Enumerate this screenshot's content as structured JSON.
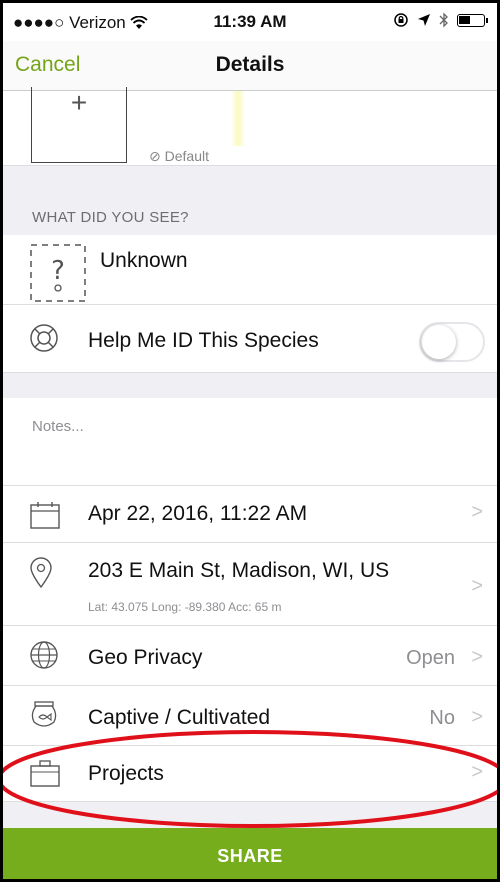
{
  "status_bar": {
    "carrier": "●●●●○ Verizon",
    "time": "11:39 AM"
  },
  "nav": {
    "cancel_label": "Cancel",
    "title": "Details"
  },
  "photo": {
    "add_symbol": "+",
    "default_label": "⊘ Default"
  },
  "what_did_you_see": {
    "header": "WHAT DID YOU SEE?",
    "species_name": "Unknown",
    "help_label": "Help Me ID This Species",
    "help_toggle_on": false
  },
  "notes": {
    "placeholder": "Notes..."
  },
  "details": {
    "date": "Apr 22, 2016, 11:22 AM",
    "location": "203 E Main St, Madison, WI, US",
    "coords": "Lat: 43.075  Long: -89.380  Acc: 65 m",
    "geo_privacy_label": "Geo Privacy",
    "geo_privacy_value": "Open",
    "captive_label": "Captive / Cultivated",
    "captive_value": "No",
    "projects_label": "Projects"
  },
  "share_label": "SHARE",
  "colors": {
    "accent_green": "#75ad1c",
    "cancel_green": "#75a419",
    "annotation_red": "#e0101a"
  }
}
